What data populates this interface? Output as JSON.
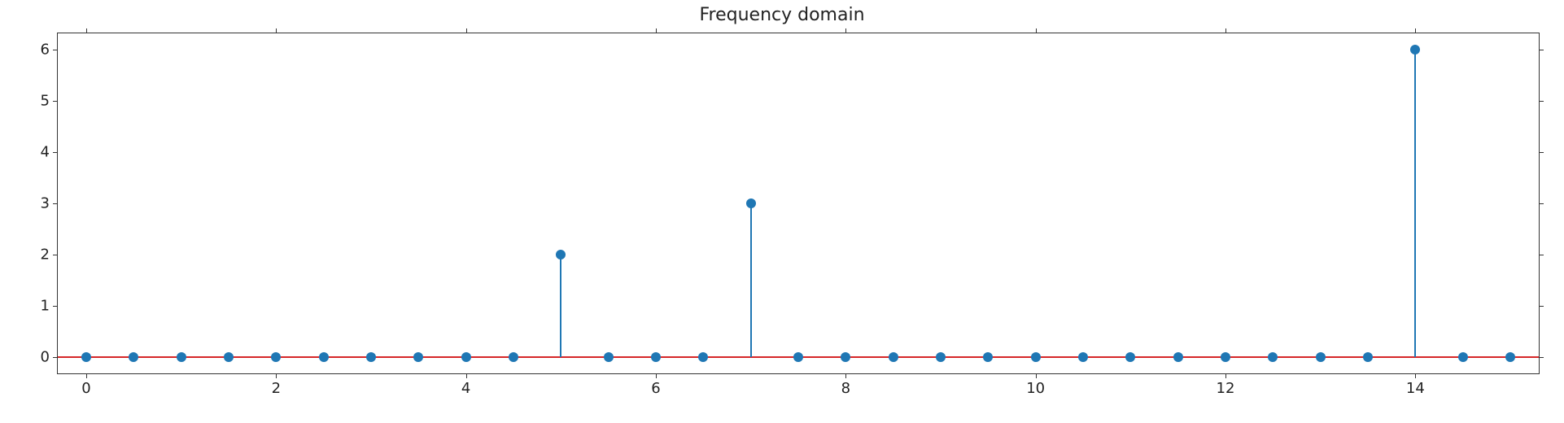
{
  "chart_data": {
    "type": "stem",
    "title": "Frequency domain",
    "xlabel": "",
    "ylabel": "",
    "xlim": [
      -0.3,
      15.3
    ],
    "ylim": [
      -0.32,
      6.32
    ],
    "x_ticks": [
      0,
      2,
      4,
      6,
      8,
      10,
      12,
      14
    ],
    "y_ticks": [
      0,
      1,
      2,
      3,
      4,
      5,
      6
    ],
    "baseline_y": 0,
    "x": [
      0,
      0.5,
      1,
      1.5,
      2,
      2.5,
      3,
      3.5,
      4,
      4.5,
      5,
      5.5,
      6,
      6.5,
      7,
      7.5,
      8,
      8.5,
      9,
      9.5,
      10,
      10.5,
      11,
      11.5,
      12,
      12.5,
      13,
      13.5,
      14,
      14.5,
      15
    ],
    "values": [
      0,
      0,
      0,
      0,
      0,
      0,
      0,
      0,
      0,
      0,
      2,
      0,
      0,
      0,
      3,
      0,
      0,
      0,
      0,
      0,
      0,
      0,
      0,
      0,
      0,
      0,
      0,
      0,
      6,
      0,
      0
    ],
    "colors": {
      "marker": "#1f77b4",
      "stem": "#1f77b4",
      "baseline": "#d62728"
    }
  }
}
